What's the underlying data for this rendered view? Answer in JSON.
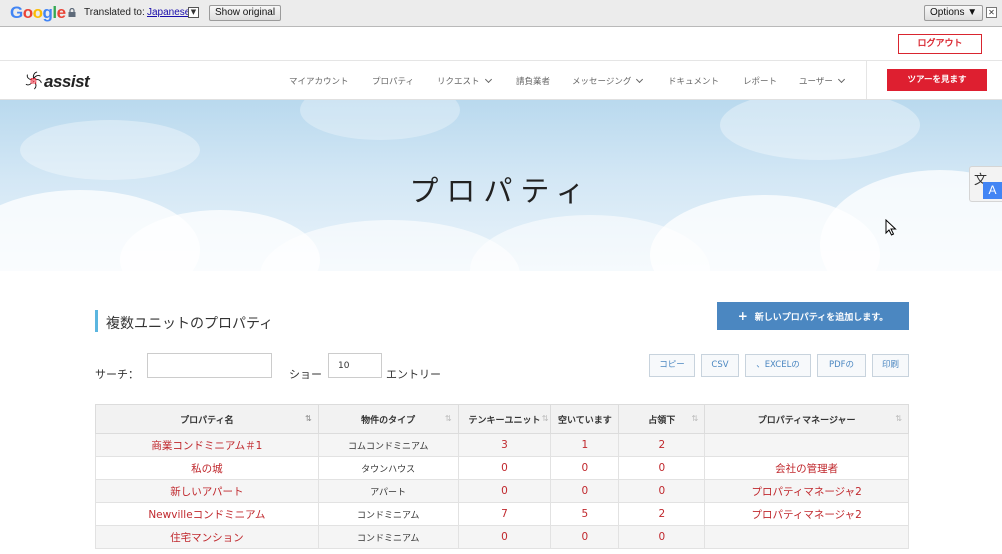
{
  "translate_bar": {
    "logo": "Google",
    "translated_to": "Translated to:",
    "language": "Japanese",
    "show_original": "Show original",
    "options": "Options ▼",
    "close": "✕"
  },
  "header": {
    "logout": "ログアウト",
    "logo_text": "assist",
    "tour": "ツアーを見ます",
    "nav": [
      {
        "label": "マイアカウント",
        "dropdown": false
      },
      {
        "label": "プロパティ",
        "dropdown": false
      },
      {
        "label": "リクエスト",
        "dropdown": true
      },
      {
        "label": "請負業者",
        "dropdown": false
      },
      {
        "label": "メッセージング",
        "dropdown": true
      },
      {
        "label": "ドキュメント",
        "dropdown": false
      },
      {
        "label": "レポート",
        "dropdown": false
      },
      {
        "label": "ユーザー",
        "dropdown": true
      }
    ]
  },
  "hero": {
    "title": "プロパティ"
  },
  "translate_widget": {
    "glyph": "文",
    "letter": "A"
  },
  "section": {
    "title": "複数ユニットのプロパティ",
    "add_button": "新しいプロパティを追加します。",
    "add_icon": "plus-icon"
  },
  "controls": {
    "search_label": "サーチ：",
    "show_label": "ショー",
    "entries_value": "10",
    "entries_label": "エントリー",
    "buttons": [
      "コピー",
      "CSV",
      "、EXCELの",
      "PDFの",
      "印刷"
    ]
  },
  "table": {
    "headers": [
      "プロパティ名",
      "物件のタイプ",
      "テンキーユニット",
      "空いています",
      "占領下",
      "プロパティマネージャー"
    ],
    "rows": [
      {
        "name": "商業コンドミニアム＃1",
        "type": "コムコンドミニアム",
        "units": "3",
        "vacant": "1",
        "occupied": "2",
        "manager": ""
      },
      {
        "name": "私の城",
        "type": "タウンハウス",
        "units": "0",
        "vacant": "0",
        "occupied": "0",
        "manager": "会社の管理者"
      },
      {
        "name": "新しいアパート",
        "type": "アパート",
        "units": "0",
        "vacant": "0",
        "occupied": "0",
        "manager": "プロパティマネージャ2"
      },
      {
        "name": "Newvilleコンドミニアム",
        "type": "コンドミニアム",
        "units": "7",
        "vacant": "5",
        "occupied": "2",
        "manager": "プロパティマネージャ2"
      },
      {
        "name": "住宅マンション",
        "type": "コンドミニアム",
        "units": "0",
        "vacant": "0",
        "occupied": "0",
        "manager": ""
      }
    ]
  },
  "colors": {
    "accent_red": "#de1f30",
    "link_red": "#c0282d",
    "button_blue": "#4b87c1",
    "section_bar": "#5bb6e0"
  }
}
